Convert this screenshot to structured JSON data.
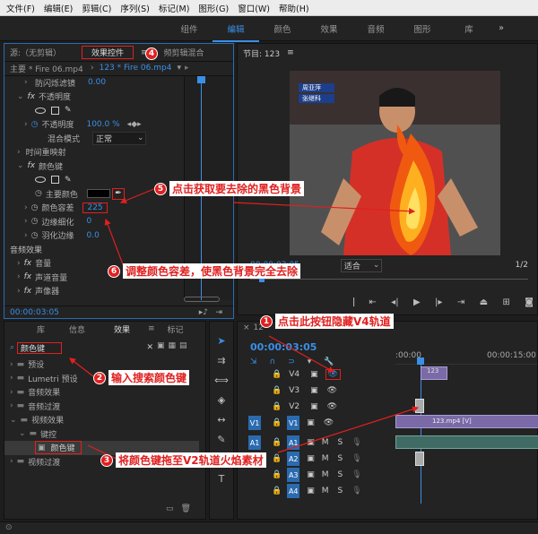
{
  "menu": [
    "文件(F)",
    "编辑(E)",
    "剪辑(C)",
    "序列(S)",
    "标记(M)",
    "图形(G)",
    "窗口(W)",
    "帮助(H)"
  ],
  "workspaces": [
    "组件",
    "编辑",
    "颜色",
    "效果",
    "音频",
    "图形",
    "库"
  ],
  "active_workspace": "编辑",
  "source_panel": {
    "tabs": [
      "源:（无剪辑）",
      "效果控件",
      "频剪辑混合"
    ],
    "master": "主要 * Fire 06.mp4",
    "clip": "123 * Fire 06.mp4",
    "rows": [
      {
        "label": "防闪烁滤镜",
        "value": "0.00",
        "indent": 2
      },
      {
        "label": "不透明度",
        "value": "",
        "indent": 1,
        "fx": true
      },
      {
        "label": "不透明度",
        "value": "100.0 %",
        "indent": 2
      },
      {
        "label": "混合模式",
        "value": "正常",
        "indent": 3
      },
      {
        "label": "时间重映射",
        "value": "",
        "indent": 1
      },
      {
        "label": "颜色键",
        "value": "",
        "indent": 1,
        "fx": true
      },
      {
        "label": "主要颜色",
        "value": "",
        "indent": 3
      },
      {
        "label": "颜色容差",
        "value": "225",
        "indent": 2
      },
      {
        "label": "边缘细化",
        "value": "0",
        "indent": 2
      },
      {
        "label": "羽化边缘",
        "value": "0.0",
        "indent": 2
      }
    ],
    "audio_title": "音频效果",
    "audio_rows": [
      "音量",
      "声道音量",
      "声像器"
    ],
    "timecode": "00:00:03:05"
  },
  "program_panel": {
    "title": "节目: 123",
    "timecode": "00:00:03:05",
    "fit": "适合",
    "ratio": "1/2"
  },
  "effects_panel": {
    "tabs": [
      "库",
      "信息",
      "效果",
      "标记"
    ],
    "search_value": "颜色键",
    "tree": [
      {
        "label": "预设",
        "indent": 0
      },
      {
        "label": "Lumetri 预设",
        "indent": 0
      },
      {
        "label": "音频效果",
        "indent": 0
      },
      {
        "label": "音频过渡",
        "indent": 0
      },
      {
        "label": "视频效果",
        "indent": 0
      },
      {
        "label": "键控",
        "indent": 1
      },
      {
        "label": "颜色键",
        "indent": 2
      },
      {
        "label": "视频过渡",
        "indent": 0
      }
    ]
  },
  "timeline": {
    "title": "12",
    "timecode": "00:00:03:05",
    "ruler": [
      ":00:00",
      "00:00:15:00"
    ],
    "video_tracks": [
      "V4",
      "V3",
      "V2",
      "V1"
    ],
    "audio_tracks": [
      "A1",
      "A2",
      "A3",
      "A4"
    ],
    "clips": {
      "v4": "123",
      "v1": "123.mp4 [V]",
      "v1b": "123.mp4 [V]"
    }
  },
  "annotations": [
    {
      "n": "1",
      "text": "点击此按钮隐藏V4轨道"
    },
    {
      "n": "2",
      "text": "输入搜索颜色键"
    },
    {
      "n": "3",
      "text": "将颜色键拖至V2轨道火焰素材"
    },
    {
      "n": "4",
      "text": ""
    },
    {
      "n": "5",
      "text": "点击获取要去除的黑色背景"
    },
    {
      "n": "6",
      "text": "调整颜色容差，使黑色背景完全去除"
    }
  ],
  "scoreboard": {
    "p1": "周亚萍",
    "p2": "张继科"
  }
}
